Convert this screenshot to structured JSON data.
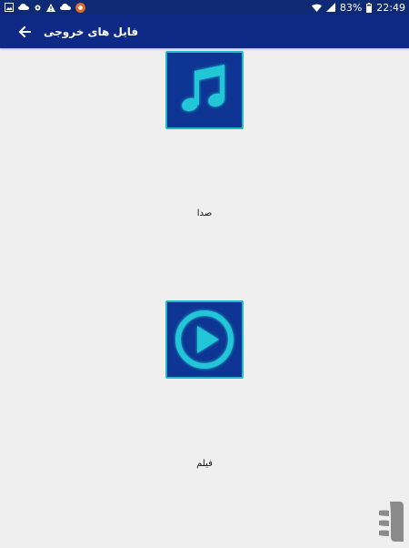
{
  "status_bar": {
    "icons_left": [
      "image-icon",
      "cloud-icon",
      "settings-icon",
      "warning-icon",
      "cloud-icon",
      "app-icon"
    ],
    "icons_right": [
      "wifi-icon",
      "signal-icon"
    ],
    "battery": "83%",
    "time": "22:49"
  },
  "app_bar": {
    "title": "فایل های خروجی",
    "back_icon": "arrow-back-icon"
  },
  "items": [
    {
      "label": "صدا",
      "icon": "music-note-icon"
    },
    {
      "label": "فیلم",
      "icon": "play-circle-icon"
    }
  ],
  "brand_logo": "brand-logo",
  "colors": {
    "status_bar": "#0f2a74",
    "app_bar": "#0f2a86",
    "background": "#efefef",
    "tile_fill": "#0e3593",
    "tile_border": "#21b8c8",
    "accent_cyan": "#24c7d7"
  }
}
